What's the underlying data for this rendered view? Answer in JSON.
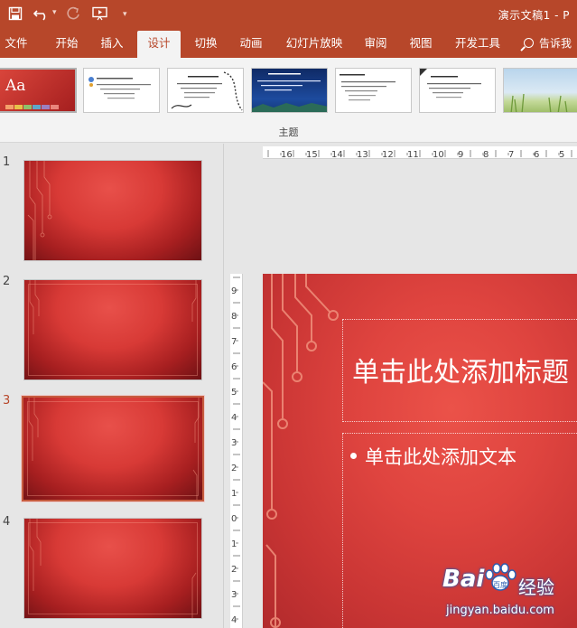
{
  "titlebar": {
    "doc_title": "演示文稿1 - P",
    "accent": "#b7472a"
  },
  "quick_access": [
    "save-icon",
    "undo-icon",
    "redo-icon",
    "present-from-start-icon",
    "customize-qat-icon"
  ],
  "tabs": [
    {
      "label": "文件"
    },
    {
      "label": "开始"
    },
    {
      "label": "插入"
    },
    {
      "label": "设计",
      "active": true
    },
    {
      "label": "切换"
    },
    {
      "label": "动画"
    },
    {
      "label": "幻灯片放映"
    },
    {
      "label": "审阅"
    },
    {
      "label": "视图"
    },
    {
      "label": "开发工具"
    }
  ],
  "tell_me": "告诉我",
  "ribbon": {
    "gallery_label": "主题",
    "selected_theme_text": "Aa",
    "themes": [
      {
        "kind": "current-red"
      },
      {
        "kind": "office-light"
      },
      {
        "kind": "office-curve"
      },
      {
        "kind": "dark-blue"
      },
      {
        "kind": "plain-white"
      },
      {
        "kind": "plain-dark-corner"
      },
      {
        "kind": "field-photo"
      }
    ]
  },
  "slides": [
    {
      "number": "1"
    },
    {
      "number": "2"
    },
    {
      "number": "3",
      "active": true
    },
    {
      "number": "4"
    }
  ],
  "rulers": {
    "horizontal_ticks": [
      "16",
      "15",
      "14",
      "13",
      "12",
      "11",
      "10",
      "9",
      "8",
      "7",
      "6",
      "5"
    ],
    "vertical_ticks": [
      "9",
      "8",
      "7",
      "6",
      "5",
      "4",
      "3",
      "2",
      "1",
      "0",
      "1",
      "2",
      "3",
      "4"
    ]
  },
  "slide_editor": {
    "title_placeholder": "单击此处添加标题",
    "body_placeholder": "单击此处添加文本"
  },
  "watermark": {
    "logo": "Bai",
    "logo_suffix": "百度",
    "brand": "经验",
    "url": "jingyan.baidu.com"
  },
  "colors": {
    "ribbon_bg": "#f3f3f3",
    "slide_red": "#df443f",
    "circuit": "#f0907c"
  }
}
